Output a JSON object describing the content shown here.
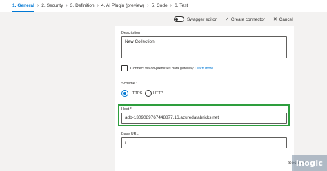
{
  "steps": [
    {
      "label": "1. General",
      "active": true
    },
    {
      "label": "2. Security",
      "active": false
    },
    {
      "label": "3. Definition",
      "active": false
    },
    {
      "label": "4. AI Plugin (preview)",
      "active": false
    },
    {
      "label": "5. Code",
      "active": false
    },
    {
      "label": "6. Test",
      "active": false
    }
  ],
  "actions": {
    "swagger_label": "Swagger editor",
    "swagger_enabled": false,
    "create_label": "Create connector",
    "cancel_label": "Cancel"
  },
  "form": {
    "description_label": "Description",
    "description_value": "New Collection",
    "gateway_checkbox_label": "Connect via on-premises data gateway",
    "gateway_learn_more": "Learn more",
    "gateway_checked": false,
    "scheme_label": "Scheme *",
    "scheme_options": [
      {
        "label": "HTTPS",
        "selected": true
      },
      {
        "label": "HTTP",
        "selected": false
      }
    ],
    "host_label": "Host *",
    "host_value": "adb-1309089767448877.16.azuredatabricks.net",
    "base_url_label": "Base URL",
    "base_url_value": "/"
  },
  "footer": {
    "next_label": "Security"
  },
  "watermark": "Inogic",
  "colors": {
    "accent": "#0078d4",
    "highlight_border": "#2e9e3e",
    "canvas_bg": "#f3f2f1"
  },
  "icons": {
    "create": "check-icon",
    "cancel": "close-icon",
    "next": "arrow-right-icon",
    "step_separator": "chevron-right-icon"
  }
}
